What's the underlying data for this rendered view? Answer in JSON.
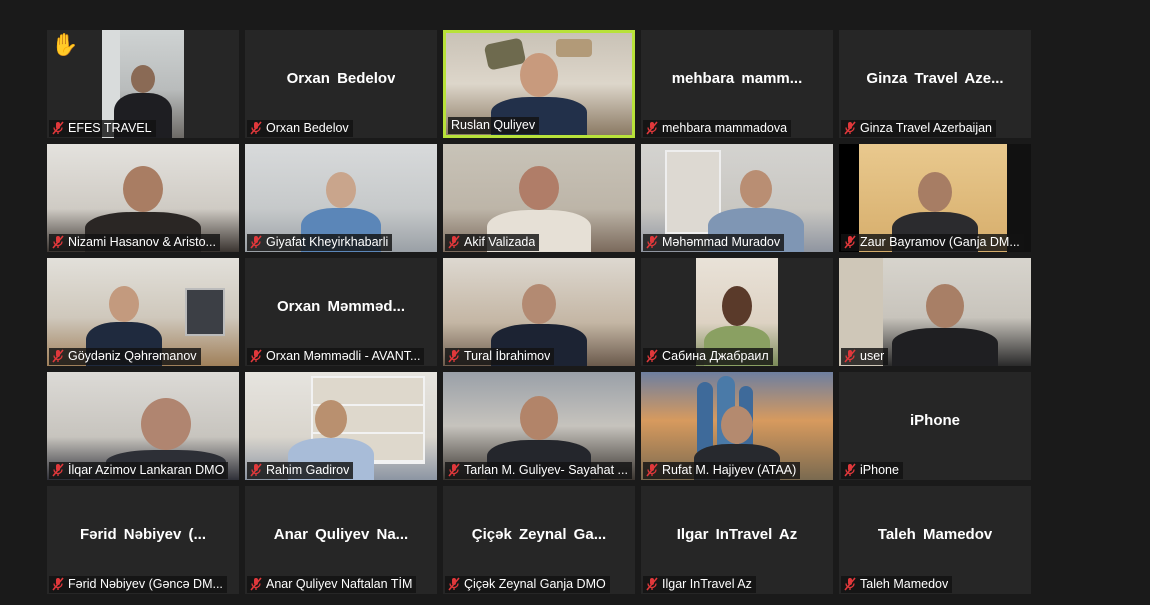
{
  "raised_hand_icon": "raised-hand-icon",
  "mic_muted_icon": "mic-muted-icon",
  "colors": {
    "background": "#1a1a1a",
    "tile": "#262626",
    "active_speaker_border": "#b8e23a",
    "muted_mic": "#e0383b"
  },
  "participants": [
    {
      "label": "EFES TRAVEL",
      "video": true,
      "hand_raised": true
    },
    {
      "label": "Orxan Bedelov",
      "display_name": "Orxan Bedelov",
      "video": false
    },
    {
      "label": "Ruslan Quliyev",
      "video": true,
      "active_speaker": true
    },
    {
      "label": "mehbara mammadova",
      "display_name": "mehbara  mamm...",
      "video": false
    },
    {
      "label": "Ginza Travel Azerbaijan",
      "display_name": "Ginza Travel Aze...",
      "video": false
    },
    {
      "label": "Nizami Hasanov  &  Aristo...",
      "video": true
    },
    {
      "label": "Giyafat Kheyirkhabarli",
      "video": true
    },
    {
      "label": "Akif Valizada",
      "video": true
    },
    {
      "label": "Məhəmmad Muradov",
      "video": true
    },
    {
      "label": "Zaur Bayramov (Ganja DM...",
      "video": true
    },
    {
      "label": "Göydəniz Qəhrəmanov",
      "video": true
    },
    {
      "label": "Orxan Məmmədli - AVANT...",
      "display_name": "Orxan  Məmməd...",
      "video": false
    },
    {
      "label": "Tural İbrahimov",
      "video": true
    },
    {
      "label": "Сабина Джабраил",
      "video": true
    },
    {
      "label": "user",
      "video": true
    },
    {
      "label": "İlqar Azimov Lankaran DMO",
      "video": true
    },
    {
      "label": "Rahim Gadirov",
      "video": true
    },
    {
      "label": "Tarlan M. Guliyev- Sayahat ...",
      "video": true
    },
    {
      "label": "Rufat M. Hajiyev (ATAA)",
      "video": true
    },
    {
      "label": "iPhone",
      "display_name": "iPhone",
      "video": false
    },
    {
      "label": "Fərid Nəbiyev (Gəncə DM...",
      "display_name": "Fərid Nəbiyev  (...",
      "video": false
    },
    {
      "label": "Anar Quliyev Naftalan TİM",
      "display_name": "Anar Quliyev Na...",
      "video": false
    },
    {
      "label": "Çiçək Zeynal Ganja DMO",
      "display_name": "Çiçək  Zeynal Ga...",
      "video": false
    },
    {
      "label": "Ilgar InTravel Az",
      "display_name": "Ilgar InTravel Az",
      "video": false
    },
    {
      "label": "Taleh Mamedov",
      "display_name": "Taleh Mamedov",
      "video": false
    }
  ]
}
